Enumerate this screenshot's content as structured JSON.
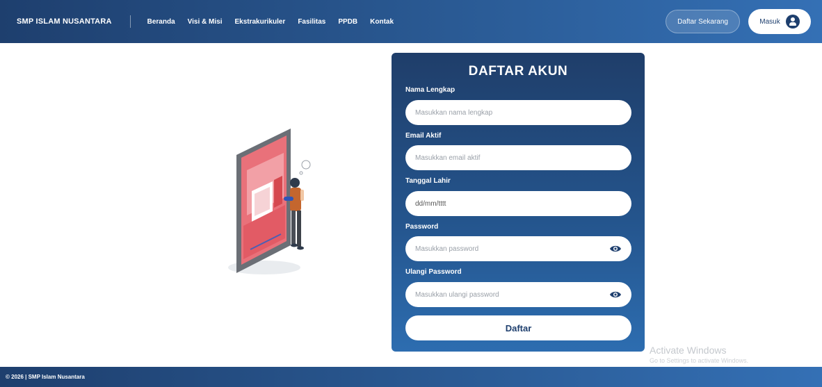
{
  "navbar": {
    "brand": "SMP ISLAM NUSANTARA",
    "links": [
      "Beranda",
      "Visi & Misi",
      "Ekstrakurikuler",
      "Fasilitas",
      "PPDB",
      "Kontak"
    ],
    "register_label": "Daftar Sekarang",
    "login_label": "Masuk",
    "login_icon": "user-circle-icon"
  },
  "form": {
    "title": "DAFTAR AKUN",
    "fields": [
      {
        "label": "Nama Lengkap",
        "placeholder": "Masukkan nama lengkap",
        "value": ""
      },
      {
        "label": "Email Aktif",
        "placeholder": "Masukkan email aktif",
        "value": ""
      },
      {
        "label": "Tanggal Lahir",
        "placeholder": "",
        "value": "dd/mm/tttt"
      },
      {
        "label": "Password",
        "placeholder": "Masukkan password",
        "value": "",
        "icon": "eye-icon"
      },
      {
        "label": "Ulangi Password",
        "placeholder": "Masukkan ulangi password",
        "value": "",
        "icon": "eye-icon"
      }
    ],
    "submit_label": "Daftar"
  },
  "watermark": {
    "title": "Activate Windows",
    "subtitle": "Go to Settings to activate Windows."
  },
  "footer": {
    "text": "© 2026 | SMP Islam Nusantara"
  },
  "colors": {
    "primary": "#1e3f6e",
    "primary_light": "#3470b5",
    "accent_red": "#e05a64"
  }
}
